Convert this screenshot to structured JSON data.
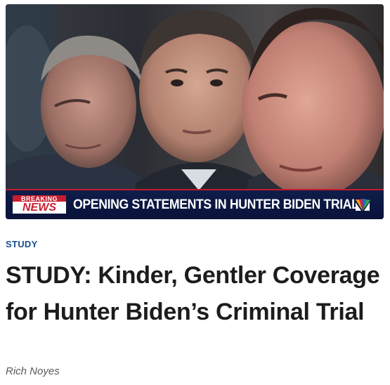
{
  "hero": {
    "ticker": {
      "badge_top": "BREAKING",
      "badge_bottom": "NEWS",
      "headline": "OPENING STATEMENTS IN HUNTER BIDEN TRIAL",
      "network_icon": "nbc-peacock-icon"
    }
  },
  "article": {
    "category": "STUDY",
    "title": "STUDY: Kinder, Gentler Coverage for Hunter Biden’s Criminal Trial",
    "author": "Rich Noyes"
  },
  "colors": {
    "category": "#1a4f8f",
    "title": "#1c1c1c",
    "author": "#595959",
    "ticker_bg": "#0b1741",
    "breaking_red": "#c81e2f"
  }
}
